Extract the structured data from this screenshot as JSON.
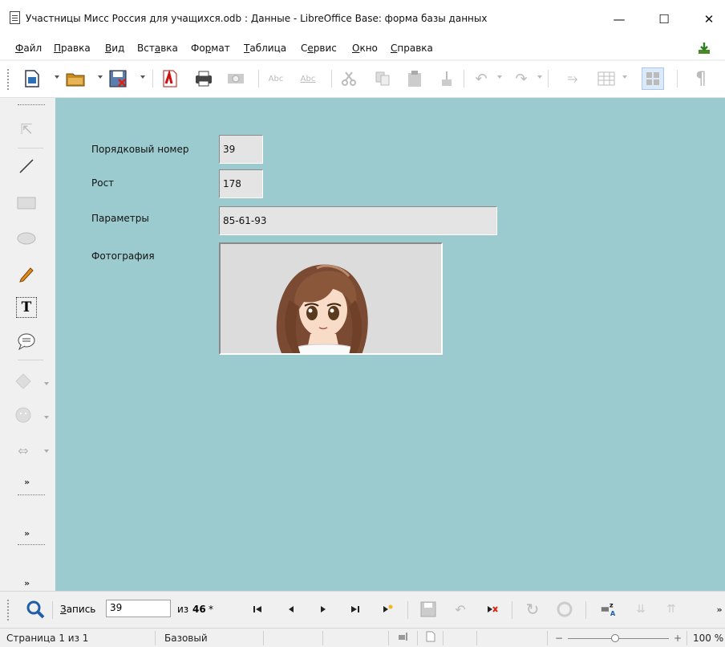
{
  "window": {
    "title": "Участницы Мисс Россия для учащихся.odb : Данные - LibreOffice Base: форма базы данных",
    "minimize": "—",
    "maximize": "☐",
    "close": "✕"
  },
  "menu": [
    {
      "pre": "",
      "u": "Ф",
      "post": "айл"
    },
    {
      "pre": "",
      "u": "П",
      "post": "равка"
    },
    {
      "pre": "",
      "u": "В",
      "post": "ид"
    },
    {
      "pre": "Вст",
      "u": "а",
      "post": "вка"
    },
    {
      "pre": "Фо",
      "u": "р",
      "post": "мат"
    },
    {
      "pre": "",
      "u": "Т",
      "post": "аблица"
    },
    {
      "pre": "С",
      "u": "е",
      "post": "рвис"
    },
    {
      "pre": "",
      "u": "О",
      "post": "кно"
    },
    {
      "pre": "",
      "u": "С",
      "post": "правка"
    }
  ],
  "form": {
    "fields": [
      {
        "label": "Порядковый номер",
        "value": "39"
      },
      {
        "label": "Рост",
        "value": "178"
      },
      {
        "label": "Параметры",
        "value": "85-61-93"
      }
    ],
    "photo_label": "Фотография"
  },
  "navigation": {
    "record_label_u": "З",
    "record_label_rest": "апись",
    "record_value": "39",
    "of_label": "из",
    "total": "46",
    "total_marker": "*"
  },
  "status": {
    "page": "Страница 1 из 1",
    "style": "Базовый",
    "zoom": "100 %"
  },
  "colors": {
    "form_background": "#9bcbce",
    "field_background": "#e4e4e4"
  }
}
